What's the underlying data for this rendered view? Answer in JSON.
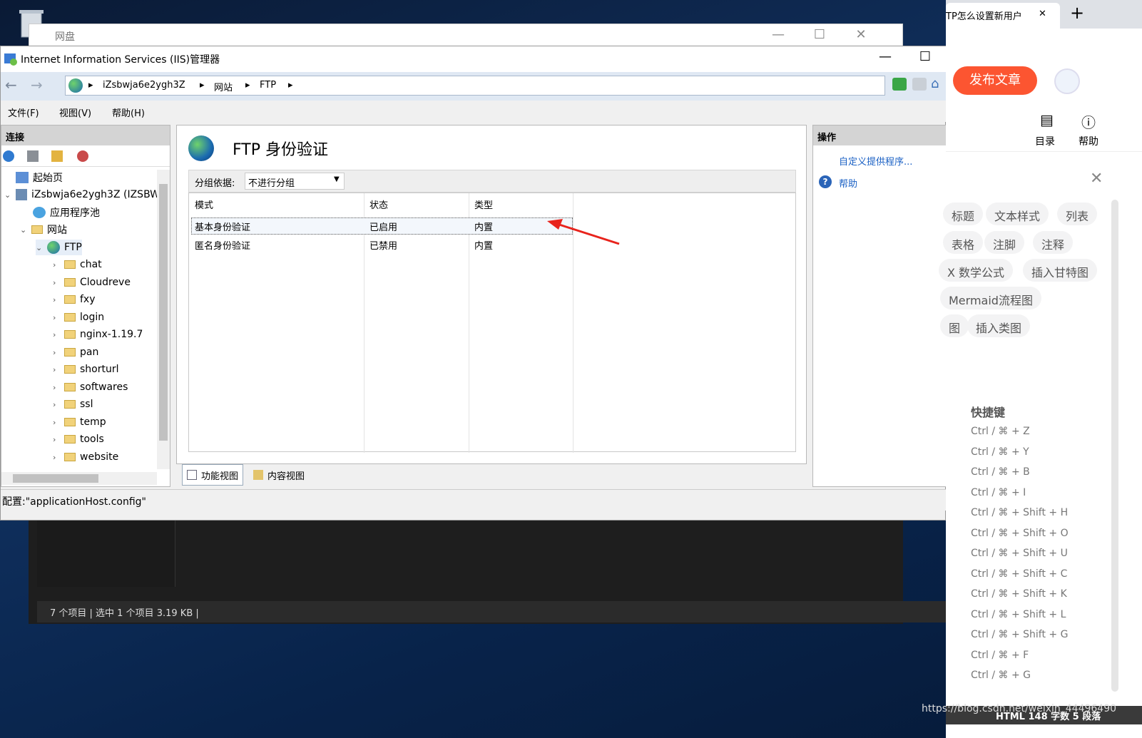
{
  "desktop": {
    "recycle_bin_label": ""
  },
  "explorer": {
    "title": "网盘",
    "status": "7 个项目  |  选中 1 个项目  3.19 KB  |"
  },
  "iis": {
    "title": "Internet Information Services (IIS)管理器",
    "breadcrumb": [
      "iZsbwja6e2ygh3Z",
      "网站",
      "FTP"
    ],
    "menu": [
      "文件(F)",
      "视图(V)",
      "帮助(H)"
    ],
    "connections_title": "连接",
    "tree": [
      {
        "label": "起始页",
        "indent": 0
      },
      {
        "label": "iZsbwja6e2ygh3Z (IZSBW",
        "indent": 0
      },
      {
        "label": "应用程序池",
        "indent": 1
      },
      {
        "label": "网站",
        "indent": 1
      },
      {
        "label": "FTP",
        "indent": 2
      },
      {
        "label": "chat",
        "indent": 3
      },
      {
        "label": "Cloudreve",
        "indent": 3
      },
      {
        "label": "fxy",
        "indent": 3
      },
      {
        "label": "login",
        "indent": 3
      },
      {
        "label": "nginx-1.19.7",
        "indent": 3
      },
      {
        "label": "pan",
        "indent": 3
      },
      {
        "label": "shorturl",
        "indent": 3
      },
      {
        "label": "softwares",
        "indent": 3
      },
      {
        "label": "ssl",
        "indent": 3
      },
      {
        "label": "temp",
        "indent": 3
      },
      {
        "label": "tools",
        "indent": 3
      },
      {
        "label": "website",
        "indent": 3
      }
    ],
    "feature_title": "FTP 身份验证",
    "group_by_label": "分组依据:",
    "group_by_value": "不进行分组",
    "columns": [
      "模式",
      "状态",
      "类型"
    ],
    "rows": [
      {
        "mode": "基本身份验证",
        "status": "已启用",
        "type": "内置"
      },
      {
        "mode": "匿名身份验证",
        "status": "已禁用",
        "type": "内置"
      }
    ],
    "actions_title": "操作",
    "actions": [
      "自定义提供程序...",
      "帮助"
    ],
    "features_view": "功能视图",
    "content_view": "内容视图",
    "status": "配置:\"applicationHost.config\""
  },
  "browser": {
    "tab_title": "TP怎么设置新用户",
    "publish": "发布文章",
    "toc": "目录",
    "help": "帮助",
    "chips": [
      "标题",
      "文本样式",
      "列表",
      "表格",
      "注脚",
      "注释",
      "X 数学公式",
      "插入甘特图",
      "Mermaid流程图",
      "图",
      "插入类图"
    ],
    "shortcuts_title": "快捷键",
    "shortcuts": [
      "Ctrl / ⌘ + Z",
      "Ctrl / ⌘ + Y",
      "Ctrl / ⌘ + B",
      "Ctrl / ⌘ + I",
      "Ctrl / ⌘ + Shift + H",
      "Ctrl / ⌘ + Shift + O",
      "Ctrl / ⌘ + Shift + U",
      "Ctrl / ⌘ + Shift + C",
      "Ctrl / ⌘ + Shift + K",
      "Ctrl / ⌘ + Shift + L",
      "Ctrl / ⌘ + Shift + G",
      "Ctrl / ⌘ + F",
      "Ctrl / ⌘ + G"
    ],
    "footer_stats": "HTML  148 字数  5 段落",
    "watermark": "https://blog.csdn.net/weixin_44496490"
  },
  "colors": {
    "publish": "#fc5531",
    "arrow": "#e8231c"
  }
}
